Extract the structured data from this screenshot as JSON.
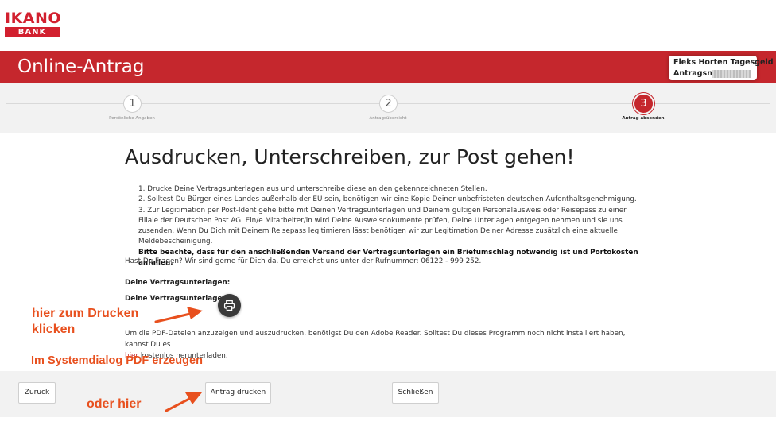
{
  "logo": {
    "top": "IKANO",
    "bottom": "BANK"
  },
  "header": {
    "title": "Online-Antrag",
    "product_name": "Fleks Horten Tagesgeld",
    "antrag_label": "Antragsnr."
  },
  "steps": [
    {
      "number": "1",
      "label": "Persönliche Angaben",
      "active": false
    },
    {
      "number": "2",
      "label": "Antragsübersicht",
      "active": false
    },
    {
      "number": "3",
      "label": "Antrag absenden",
      "active": true
    }
  ],
  "content": {
    "title": "Ausdrucken, Unterschreiben, zur Post gehen!",
    "instructions": [
      "1. Drucke Deine Vertragsunterlagen aus und unterschreibe diese an den gekennzeichneten Stellen.",
      "2. Solltest Du Bürger eines Landes außerhalb der EU sein, benötigen wir eine Kopie Deiner unbefristeten deutschen Aufenthaltsgenehmigung.",
      "3. Zur Legitimation per Post-Ident gehe bitte mit Deinen Vertragsunterlagen und Deinem gültigen Personalausweis oder Reisepass zu einer Filiale der Deutschen Post AG. Ein/e Mitarbeiter/in wird Deine Ausweisdokumente prüfen, Deine Unterlagen entgegen nehmen und sie uns zusenden. Wenn Du Dich mit Deinem Reisepass legitimieren lässt benötigen wir zur Legitimation Deiner Adresse zusätzlich eine aktuelle Meldebescheinigung."
    ],
    "instructions_bold": "Bitte beachte, dass für den anschließenden Versand der Vertragsunterlagen ein Briefumschlag notwendig ist und Portokosten anfallen.",
    "contact": "Hast Du Fragen? Wir sind gerne für Dich da. Du erreichst uns unter der Rufnummer: 06122 - 999 252.",
    "vertrag_label_1": "Deine Vertragsunterlagen:",
    "vertrag_label_2": "Deine Vertragsunterlagen:",
    "adobe_text": "Um die PDF-Dateien anzuzeigen und auszudrucken, benötigst Du den Adobe Reader. Solltest Du dieses Programm noch nicht installiert haben, kannst Du es",
    "adobe_link": "hier",
    "adobe_suffix": "kostenlos herunterladen."
  },
  "annotations": {
    "print_line1": "hier zum Drucken",
    "print_line2": "klicken",
    "system_dialog": "Im Systemdialog PDF erzeugen",
    "or_here": "oder hier"
  },
  "footer": {
    "back": "Zurück",
    "print_application": "Antrag drucken",
    "close": "Schließen"
  },
  "colors": {
    "brand_red": "#c5272d",
    "annotation_orange": "#e8501e",
    "print_button": "#3a3a3a"
  },
  "icons": {
    "print": "printer-icon"
  }
}
